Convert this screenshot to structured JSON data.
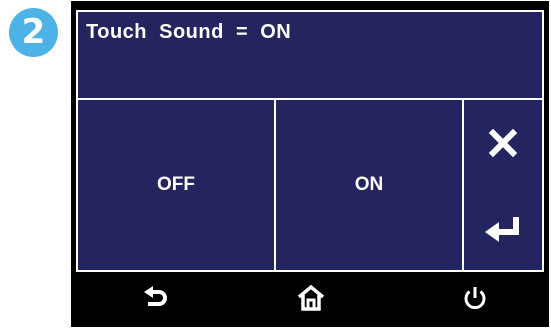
{
  "step_badge": "2",
  "screen": {
    "title": "Touch  Sound  =  ON"
  },
  "options": [
    {
      "label": "OFF"
    },
    {
      "label": "ON"
    }
  ],
  "side_buttons": {
    "cancel_icon": "close-icon",
    "enter_icon": "enter-return-icon"
  },
  "nav": {
    "back_icon": "back-arrow-icon",
    "home_icon": "home-icon",
    "power_icon": "power-icon"
  },
  "colors": {
    "screen_bg": "#24245e",
    "bezel": "#000000",
    "badge": "#4db3e6",
    "text": "#ffffff"
  }
}
